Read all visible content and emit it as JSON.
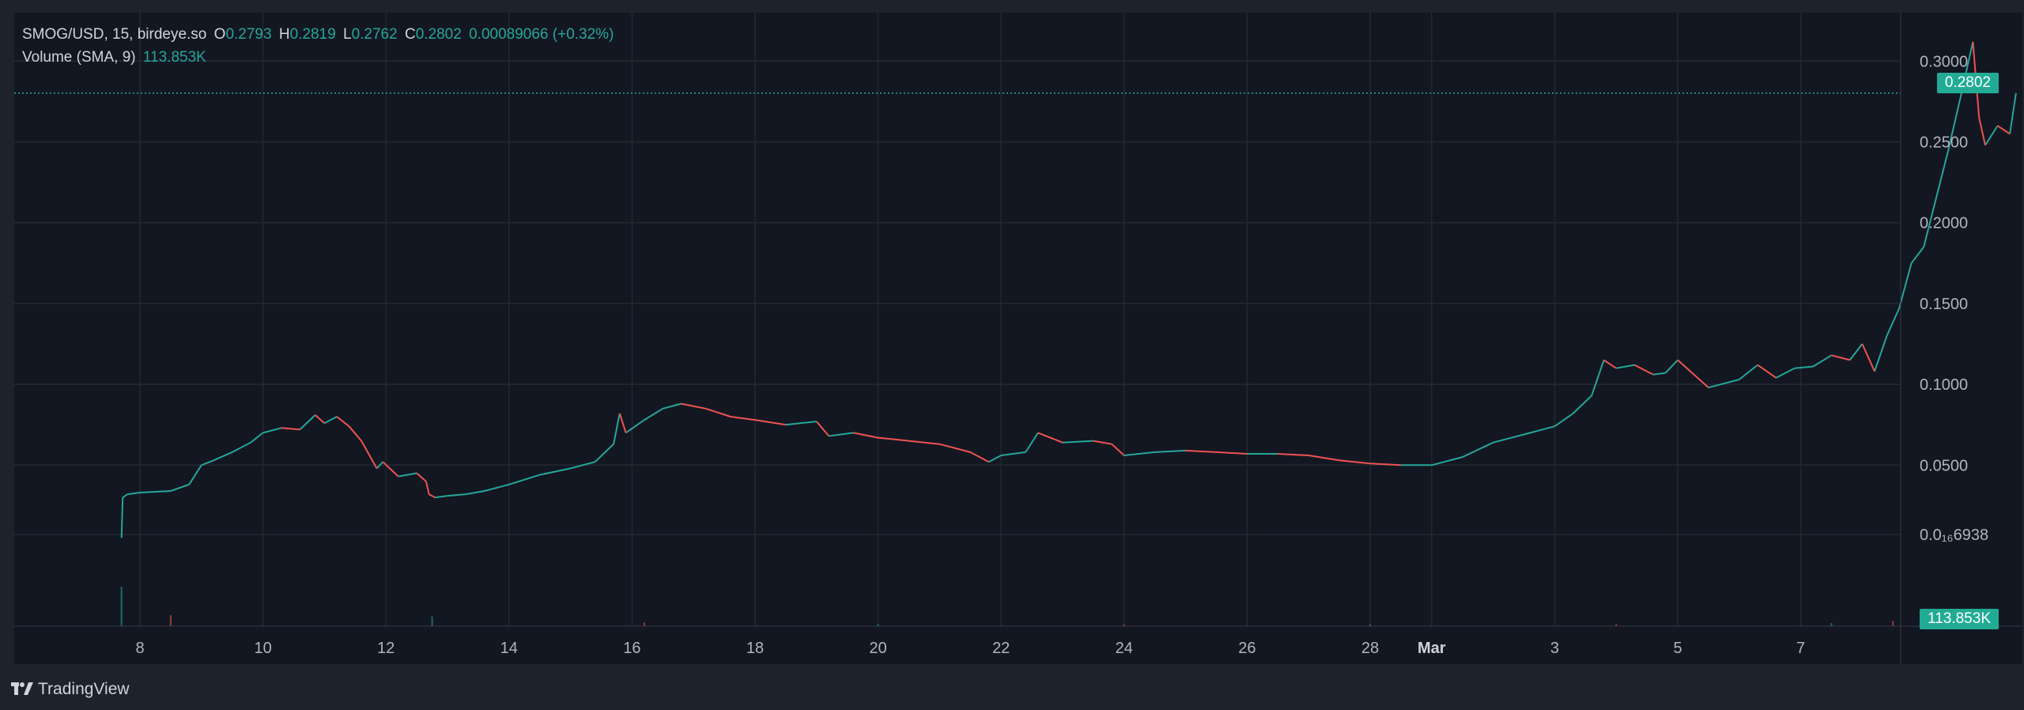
{
  "legend": {
    "symbol": "SMOG/USD, 15, birdeye.so",
    "o_label": "O",
    "o_value": "0.2793",
    "h_label": "H",
    "h_value": "0.2819",
    "l_label": "L",
    "l_value": "0.2762",
    "c_label": "C",
    "c_value": "0.2802",
    "change": "0.00089066 (+0.32%)",
    "volume_label": "Volume (SMA, 9)",
    "volume_value": "113.853K"
  },
  "price_axis": {
    "ticks": [
      "0.3000",
      "0.2500",
      "0.2000",
      "0.1500",
      "0.1000",
      "0.0500"
    ],
    "small_tick": "0.0₁₆6938",
    "last_price_label": "0.2802",
    "volume_label": "113.853K"
  },
  "time_axis": {
    "ticks": [
      "8",
      "10",
      "12",
      "14",
      "16",
      "18",
      "20",
      "22",
      "24",
      "26",
      "28",
      "Mar",
      "3",
      "5",
      "7"
    ]
  },
  "branding": {
    "name": "TradingView"
  },
  "colors": {
    "background": "#1e222d",
    "pane": "#131722",
    "grid": "#242832",
    "up": "#26a69a",
    "down": "#ef5350",
    "last_price_badge": "#22ab94",
    "axis_text": "#b2b5be"
  },
  "chart_data": {
    "type": "line",
    "title": "SMOG/USD, 15, birdeye.so",
    "xlabel": "",
    "ylabel": "",
    "ylim": [
      0.0,
      0.31
    ],
    "x_start": "Feb 7",
    "x_end": "Mar 7",
    "grid": true,
    "last_price": 0.2802,
    "series": [
      {
        "name": "SMOG/USD",
        "x": [
          7.7,
          7.72,
          7.8,
          8.0,
          8.5,
          8.8,
          9.0,
          9.2,
          9.5,
          9.8,
          10.0,
          10.3,
          10.6,
          10.85,
          11.0,
          11.2,
          11.4,
          11.6,
          11.85,
          11.95,
          12.2,
          12.5,
          12.65,
          12.7,
          12.8,
          13.0,
          13.3,
          13.6,
          14.0,
          14.5,
          15.0,
          15.4,
          15.7,
          15.8,
          15.9,
          16.2,
          16.5,
          16.8,
          17.2,
          17.6,
          18.0,
          18.5,
          19.0,
          19.2,
          19.6,
          20.0,
          20.5,
          21.0,
          21.5,
          21.8,
          22.0,
          22.4,
          22.6,
          23.0,
          23.5,
          23.8,
          24.0,
          24.5,
          25.0,
          25.5,
          26.0,
          26.5,
          27.0,
          27.5,
          28.0,
          28.5,
          29.0,
          29.5,
          30.0,
          30.5,
          31.0,
          31.3,
          31.6,
          31.8,
          32.0,
          32.3,
          32.6,
          32.8,
          33.0,
          33.5,
          34.0,
          34.3,
          34.6,
          34.9,
          35.2,
          35.5,
          35.8,
          36.0,
          36.2,
          36.4,
          36.6,
          36.8,
          37.0,
          37.2,
          37.4,
          37.6,
          37.8,
          37.9,
          38.0,
          38.2,
          38.4,
          38.5
        ],
        "values": [
          0.005,
          0.03,
          0.032,
          0.033,
          0.034,
          0.038,
          0.05,
          0.053,
          0.058,
          0.064,
          0.07,
          0.073,
          0.072,
          0.081,
          0.076,
          0.08,
          0.074,
          0.065,
          0.048,
          0.052,
          0.043,
          0.045,
          0.04,
          0.032,
          0.03,
          0.031,
          0.032,
          0.034,
          0.038,
          0.044,
          0.048,
          0.052,
          0.063,
          0.082,
          0.07,
          0.078,
          0.085,
          0.088,
          0.085,
          0.08,
          0.078,
          0.075,
          0.077,
          0.068,
          0.07,
          0.067,
          0.065,
          0.063,
          0.058,
          0.052,
          0.056,
          0.058,
          0.07,
          0.064,
          0.065,
          0.063,
          0.056,
          0.058,
          0.059,
          0.058,
          0.057,
          0.057,
          0.056,
          0.053,
          0.051,
          0.05,
          0.05,
          0.055,
          0.064,
          0.069,
          0.074,
          0.082,
          0.093,
          0.115,
          0.11,
          0.112,
          0.106,
          0.107,
          0.115,
          0.098,
          0.103,
          0.112,
          0.104,
          0.11,
          0.111,
          0.118,
          0.115,
          0.125,
          0.108,
          0.13,
          0.147,
          0.175,
          0.185,
          0.215,
          0.245,
          0.278,
          0.312,
          0.265,
          0.248,
          0.26,
          0.255,
          0.2802
        ]
      },
      {
        "name": "Volume (SMA, 9)",
        "x": [
          7.7,
          8.5,
          12.75,
          16.2,
          20.0,
          24.0,
          28.0,
          32.0,
          35.5,
          36.5,
          37.0,
          37.3
        ],
        "values": [
          9000,
          2500,
          2200,
          800,
          500,
          400,
          400,
          500,
          700,
          1200,
          1800,
          1500
        ]
      }
    ]
  }
}
